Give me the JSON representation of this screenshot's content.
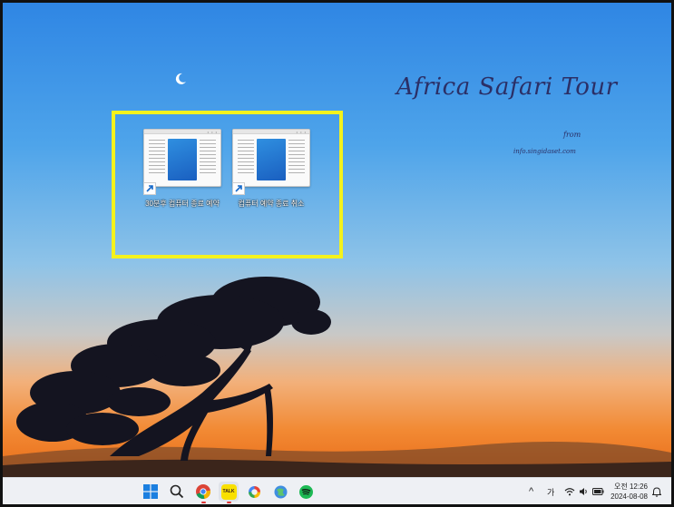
{
  "desktop": {
    "wallpaper_title": "Africa Safari Tour",
    "from_label": "from",
    "credit": "info.singidaset.com",
    "highlight_color": "#f4f21c",
    "icons": [
      {
        "label": "30분후 컴퓨터 종료 예약",
        "icon": "document-shortcut-icon"
      },
      {
        "label": "컴퓨터 예약 종료 취소",
        "icon": "document-shortcut-icon"
      }
    ]
  },
  "taskbar": {
    "apps": [
      {
        "name": "start",
        "icon": "windows-start-icon"
      },
      {
        "name": "search",
        "icon": "search-icon"
      },
      {
        "name": "chrome",
        "icon": "chrome-icon"
      },
      {
        "name": "kakaotalk",
        "icon": "talk-icon",
        "icon_text": "TALK"
      },
      {
        "name": "app5",
        "icon": "colorful-app-icon"
      },
      {
        "name": "app6",
        "icon": "globe-app-icon"
      },
      {
        "name": "spotify",
        "icon": "spotify-icon"
      }
    ],
    "tray": {
      "chevron": "^",
      "ime": "가",
      "clock_ampm_time": "오전 12:26",
      "clock_date": "2024-08-08"
    }
  }
}
